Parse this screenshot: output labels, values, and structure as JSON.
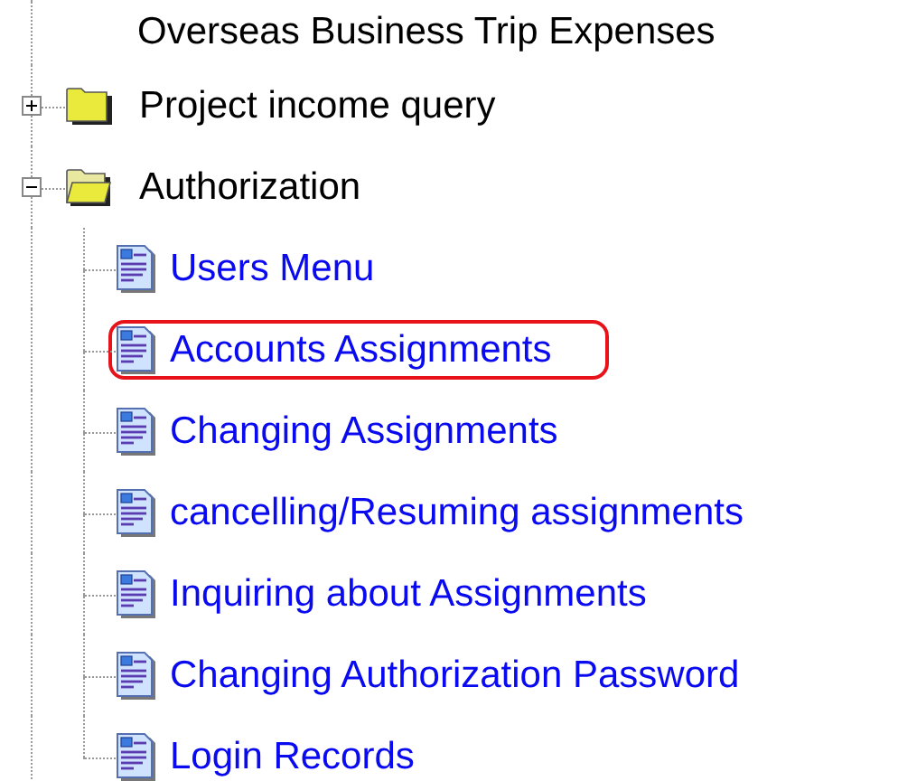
{
  "tree": {
    "items": [
      {
        "kind": "label",
        "label": "Overseas Business Trip Expenses"
      },
      {
        "kind": "folder",
        "label": "Project income query",
        "expanded": false
      },
      {
        "kind": "folder",
        "label": "Authorization",
        "expanded": true,
        "children": [
          {
            "label": "Users Menu",
            "highlighted": false
          },
          {
            "label": "Accounts Assignments",
            "highlighted": true
          },
          {
            "label": "Changing Assignments",
            "highlighted": false
          },
          {
            "label": "cancelling/Resuming assignments",
            "highlighted": false
          },
          {
            "label": "Inquiring about Assignments",
            "highlighted": false
          },
          {
            "label": "Changing Authorization Password",
            "highlighted": false
          },
          {
            "label": "Login Records",
            "highlighted": false
          }
        ]
      }
    ]
  }
}
